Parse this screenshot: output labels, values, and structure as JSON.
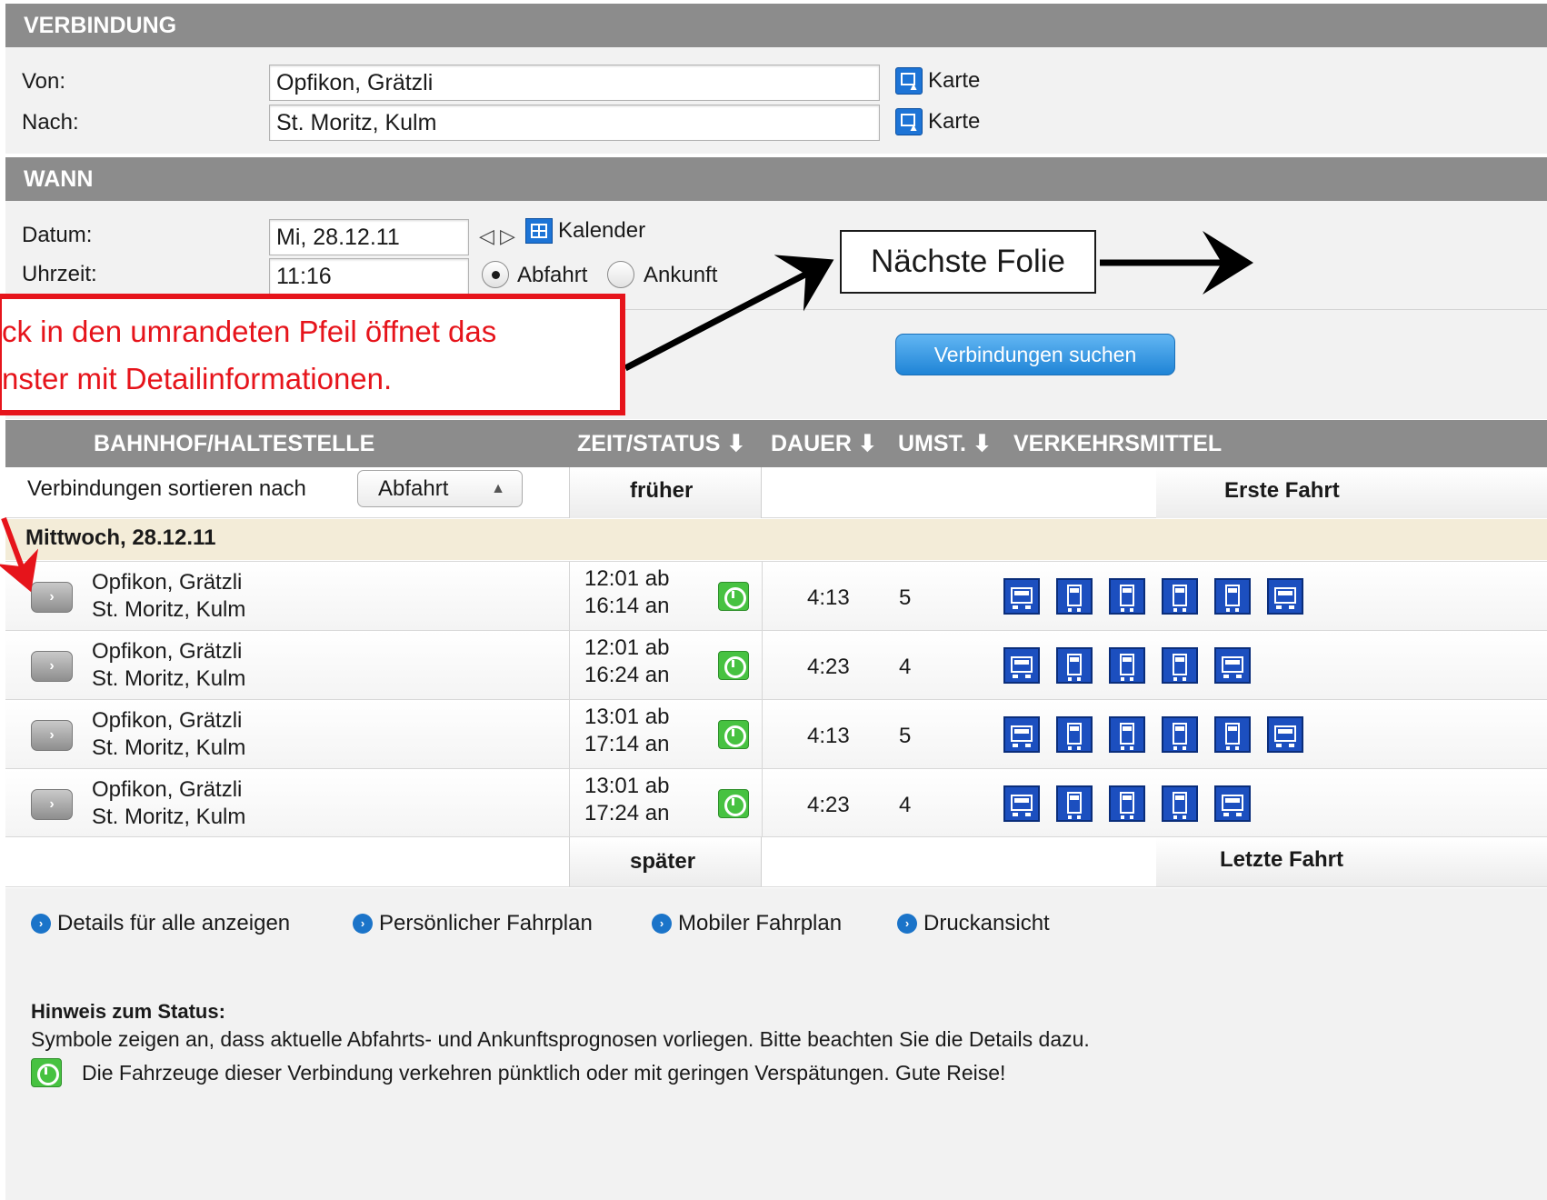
{
  "verbindung": {
    "title": "VERBINDUNG",
    "von_label": "Von:",
    "von_value": "Opfikon, Grätzli",
    "nach_label": "Nach:",
    "nach_value": "St. Moritz, Kulm",
    "map_label": "Karte"
  },
  "wann": {
    "title": "WANN",
    "datum_label": "Datum:",
    "datum_value": "Mi, 28.12.11",
    "uhrzeit_label": "Uhrzeit:",
    "uhrzeit_value": "11:16",
    "prev_arrow": "◁",
    "next_arrow": "▷",
    "kalender_label": "Kalender",
    "abfahrt_label": "Abfahrt",
    "ankunft_label": "Ankunft",
    "selected_mode": "Abfahrt"
  },
  "search_button": "Verbindungen suchen",
  "results": {
    "headers": {
      "station": "BAHNHOF/HALTESTELLE",
      "zeit": "ZEIT/STATUS ⬇",
      "dauer": "DAUER ⬇",
      "umst": "UMST. ⬇",
      "verkehrsmittel": "VERKEHRSMITTEL"
    },
    "sort_label": "Verbindungen sortieren nach",
    "sort_value": "Abfahrt",
    "frueher": "früher",
    "erste_fahrt": "Erste Fahrt",
    "spaeter": "später",
    "letzte_fahrt": "Letzte Fahrt",
    "date_heading": "Mittwoch, 28.12.11",
    "rows": [
      {
        "from": "Opfikon, Grätzli",
        "to": "St. Moritz, Kulm",
        "dep": "12:01 ab",
        "arr": "16:14 an",
        "dauer": "4:13",
        "umst": "5",
        "vehicles": [
          "bus",
          "train",
          "train",
          "train",
          "train",
          "bus"
        ]
      },
      {
        "from": "Opfikon, Grätzli",
        "to": "St. Moritz, Kulm",
        "dep": "12:01 ab",
        "arr": "16:24 an",
        "dauer": "4:23",
        "umst": "4",
        "vehicles": [
          "bus",
          "train",
          "train",
          "train",
          "bus"
        ]
      },
      {
        "from": "Opfikon, Grätzli",
        "to": "St. Moritz, Kulm",
        "dep": "13:01 ab",
        "arr": "17:14 an",
        "dauer": "4:13",
        "umst": "5",
        "vehicles": [
          "bus",
          "train",
          "train",
          "train",
          "train",
          "bus"
        ]
      },
      {
        "from": "Opfikon, Grätzli",
        "to": "St. Moritz, Kulm",
        "dep": "13:01 ab",
        "arr": "17:24 an",
        "dauer": "4:23",
        "umst": "4",
        "vehicles": [
          "bus",
          "train",
          "train",
          "train",
          "bus"
        ]
      }
    ]
  },
  "links": [
    "Details für alle anzeigen",
    "Persönlicher Fahrplan",
    "Mobiler Fahrplan",
    "Druckansicht"
  ],
  "hinweis": {
    "title": "Hinweis zum Status:",
    "text": "Symbole zeigen an, dass aktuelle Abfahrts- und Ankunftsprognosen vorliegen. Bitte beachten Sie die Details dazu.",
    "status_text": "Die Fahrzeuge dieser Verbindung verkehren pünktlich oder mit geringen Verspätungen. Gute Reise!"
  },
  "annotations": {
    "red_line1": "ck in den umrandeten Pfeil öffnet das",
    "red_line2": "nster mit Detailinformationen.",
    "next_slide": "Nächste Folie"
  },
  "colors": {
    "header_gray": "#8c8c8c",
    "band_gray": "#f2f2f2",
    "date_row": "#f3ecd8",
    "accent_blue": "#1d74d6",
    "status_green": "#47c241",
    "callout_red": "#e6141b"
  }
}
